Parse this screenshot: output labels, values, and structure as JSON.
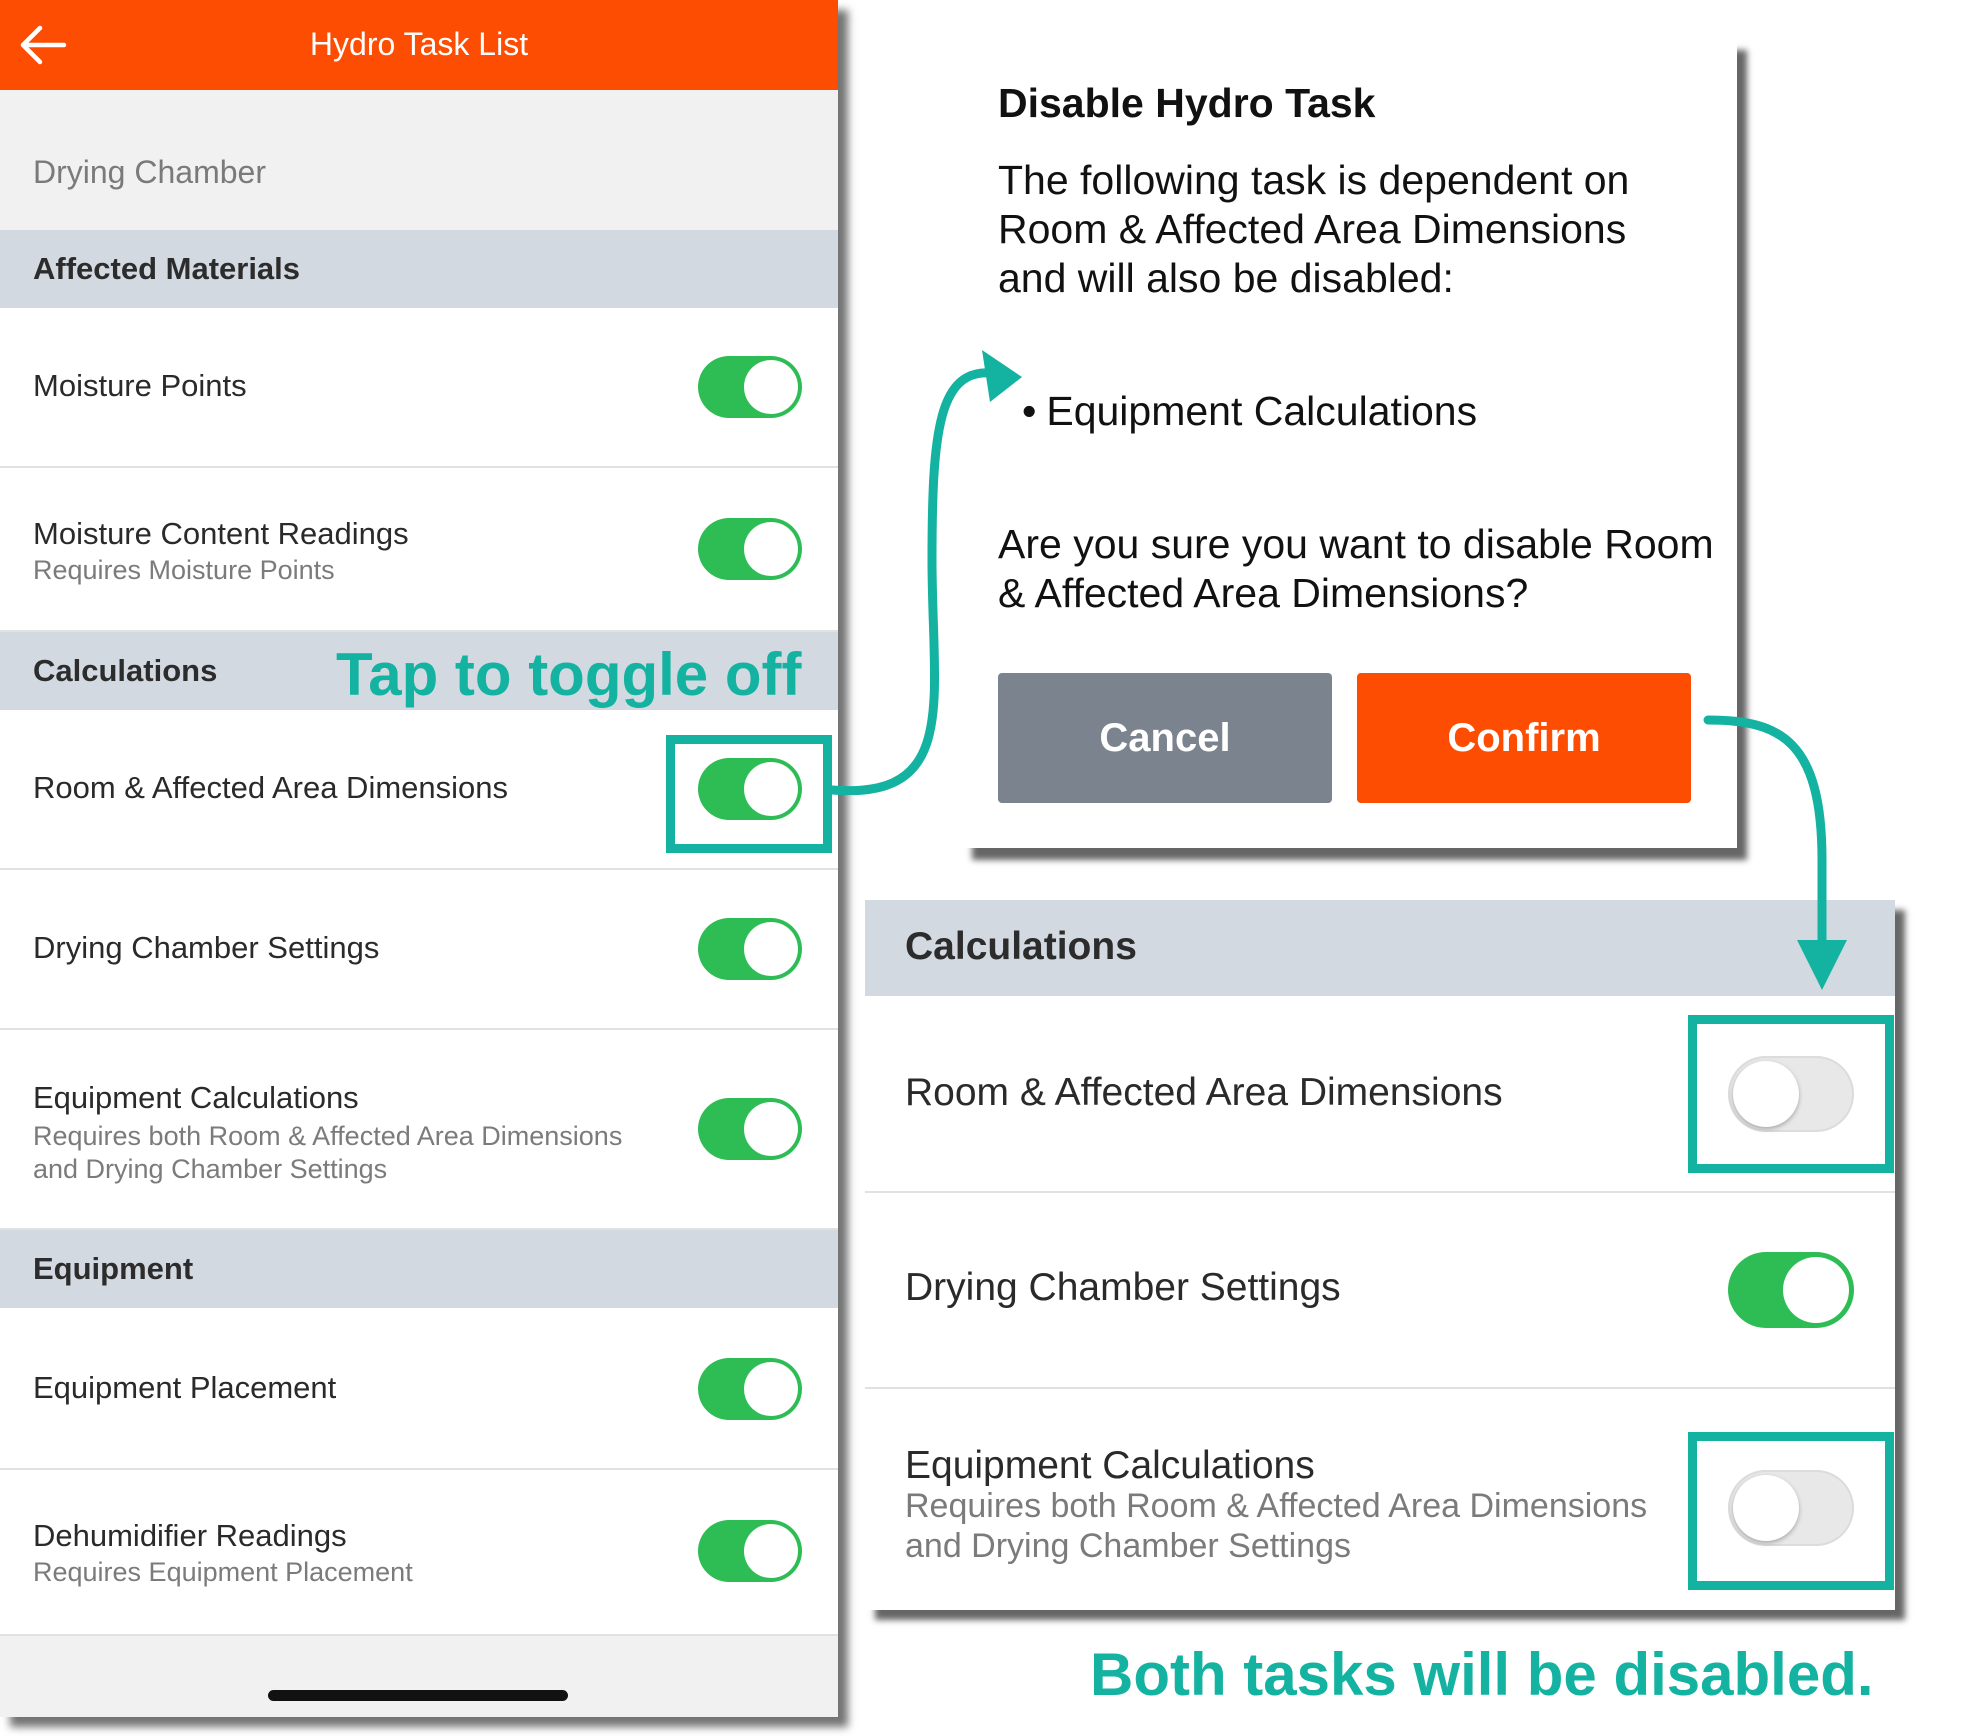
{
  "phone": {
    "title": "Hydro Task List",
    "chamber": "Drying Chamber",
    "sections": [
      {
        "label": "Affected Materials",
        "rows": [
          {
            "title": "Moisture Points",
            "sub": "",
            "on": true
          },
          {
            "title": "Moisture Content Readings",
            "sub": "Requires Moisture Points",
            "on": true
          }
        ]
      },
      {
        "label": "Calculations",
        "rows": [
          {
            "title": "Room & Affected Area Dimensions",
            "sub": "",
            "on": true
          },
          {
            "title": "Drying Chamber Settings",
            "sub": "",
            "on": true
          },
          {
            "title": "Equipment Calculations",
            "sub": "Requires both Room & Affected Area Dimensions and Drying Chamber Settings",
            "on": true
          }
        ]
      },
      {
        "label": "Equipment",
        "rows": [
          {
            "title": "Equipment Placement",
            "sub": "",
            "on": true
          },
          {
            "title": "Dehumidifier Readings",
            "sub": "Requires Equipment Placement",
            "on": true
          }
        ]
      }
    ]
  },
  "dialog": {
    "title": "Disable Hydro Task",
    "message": "The following task is dependent on Room & Affected Area Dimensions and will also be disabled:",
    "bullet": "Equipment Calculations",
    "question": "Are you sure you want to disable Room & Affected Area Dimensions?",
    "cancel_label": "Cancel",
    "confirm_label": "Confirm"
  },
  "result": {
    "section": "Calculations",
    "rows": [
      {
        "title": "Room & Affected Area Dimensions",
        "sub": "",
        "on": false
      },
      {
        "title": "Drying Chamber Settings",
        "sub": "",
        "on": true
      },
      {
        "title": "Equipment Calculations",
        "sub": "Requires both Room & Affected Area Dimensions and Drying Chamber Settings",
        "on": false
      }
    ]
  },
  "annotations": {
    "tap_hint": "Tap to toggle off",
    "result_note": "Both tasks will be disabled."
  },
  "colors": {
    "brand_orange": "#fd4d02",
    "toggle_on": "#2ebd55",
    "toggle_off": "#e8e8e8",
    "section_bg": "#d3d9e1",
    "annotation_teal": "#14b2a0",
    "cancel_gray": "#7b838e"
  }
}
